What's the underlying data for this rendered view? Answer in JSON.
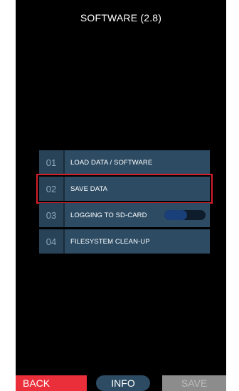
{
  "screen": {
    "title": "SOFTWARE (2.8)"
  },
  "menu": {
    "items": [
      {
        "number": "01",
        "label": "LOAD DATA / SOFTWARE"
      },
      {
        "number": "02",
        "label": "SAVE DATA"
      },
      {
        "number": "03",
        "label": "LOGGING TO SD-CARD",
        "toggle_level_percent": 55
      },
      {
        "number": "04",
        "label": "FILESYSTEM CLEAN-UP"
      }
    ],
    "selected_index": 1
  },
  "footer": {
    "back_label": "BACK",
    "info_label": "INFO",
    "save_label": "SAVE"
  },
  "colors": {
    "background": "#000000",
    "menu_item": "#2d4c64",
    "selection_outline": "#d61f2a",
    "back_button": "#ea2f3a",
    "save_button_disabled": "#8c8c8c"
  }
}
